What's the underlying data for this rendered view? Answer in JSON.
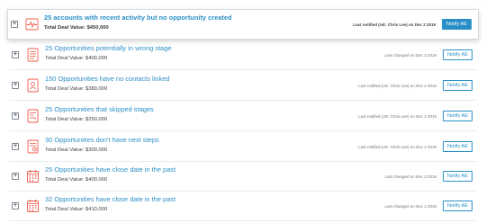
{
  "colors": {
    "accent": "#2b8fc7",
    "icon": "#f05a4a",
    "border": "#e9ecef"
  },
  "items": [
    {
      "title": "25 accounts with recent activity but no opportunity created",
      "value": "Total Deal Value: $450,000",
      "meta": "Last notified (AE: Chris Lee) on Dec 2 2019",
      "button": "Notify AE",
      "icon": "activity-pulse-icon"
    },
    {
      "title": "25 Opportunities potentially in wrong stage",
      "value": "Total Deal Value: $400,000",
      "meta": "Last changed on Dec 3 2019",
      "button": "Notify AE",
      "icon": "stage-list-icon"
    },
    {
      "title": "150 Opportunities have no contacts linked",
      "value": "Total Deal Value: $380,000",
      "meta": "Last notified (AE: Chris Lee) on Dec 2 2019",
      "button": "Notify AE",
      "icon": "contact-card-icon"
    },
    {
      "title": "25 Opportunities that skipped stages",
      "value": "Total Deal Value: $250,000",
      "meta": "Last notified (AE: Chris Lee) on Dec 2 2019",
      "button": "Notify AE",
      "icon": "skipped-stages-icon"
    },
    {
      "title": "30 Opportunities don't have next steps",
      "value": "Total Deal Value: $300,000",
      "meta": "Last notified (AE: Chris Lee) on Dec 2 2019",
      "button": "Notify AE",
      "icon": "next-steps-icon"
    },
    {
      "title": "25 Opportunities have close date in the past",
      "value": "Total Deal Value: $400,000",
      "meta": "Last changed on Dec 3 2019",
      "button": "Notify AE",
      "icon": "calendar-icon"
    },
    {
      "title": "32 Opportunities have close date in the past",
      "value": "Total Deal Value: $410,000",
      "meta": "Last changed on Dec 4 2019",
      "button": "Notify AE",
      "icon": "calendar-icon"
    }
  ]
}
